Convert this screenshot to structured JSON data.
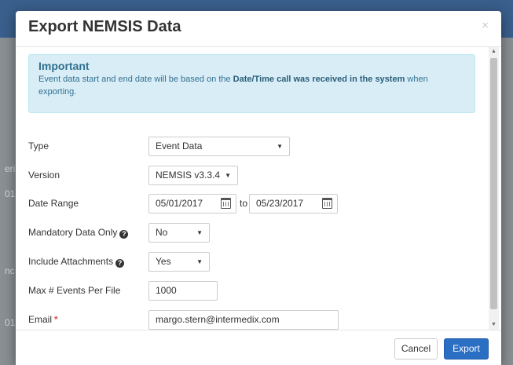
{
  "background": {
    "fragments": [
      "eric",
      "01",
      "nc",
      "01"
    ]
  },
  "modal": {
    "title": "Export NEMSIS Data",
    "close_glyph": "×",
    "alert": {
      "title": "Important",
      "text_before": "Event data start and end date will be based on the ",
      "text_bold": "Date/Time call was received in the system",
      "text_after": " when exporting."
    },
    "form": {
      "type": {
        "label": "Type",
        "value": "Event Data"
      },
      "version": {
        "label": "Version",
        "value": "NEMSIS v3.3.4"
      },
      "date_range": {
        "label": "Date Range",
        "start": "05/01/2017",
        "separator": "to",
        "end": "05/23/2017"
      },
      "mandatory": {
        "label": "Mandatory Data Only",
        "value": "No"
      },
      "attachments": {
        "label": "Include Attachments",
        "value": "Yes"
      },
      "max_events": {
        "label": "Max # Events Per File",
        "value": "1000"
      },
      "email": {
        "label": "Email",
        "required_mark": "*",
        "value": "margo.stern@intermedix.com"
      }
    },
    "footer": {
      "cancel_label": "Cancel",
      "export_label": "Export"
    }
  },
  "colors": {
    "primary": "#2a6fc4",
    "alert_bg": "#d9edf7",
    "alert_text": "#31708f",
    "required": "#d9534f"
  },
  "icons": {
    "help": "question-circle-icon",
    "calendar": "calendar-icon",
    "caret": "caret-down-icon"
  }
}
